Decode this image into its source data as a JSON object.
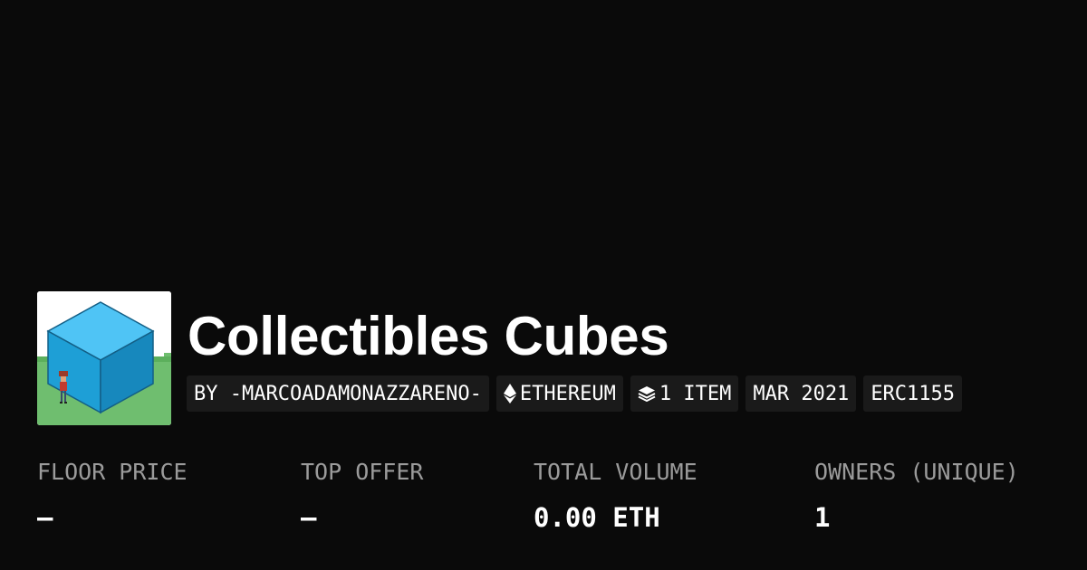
{
  "collection": {
    "name": "Collectibles Cubes",
    "avatar_icon": "isometric-blue-cube-image"
  },
  "tags": [
    {
      "label": "BY -MARCOADAMONAZZARENO-",
      "icon": null
    },
    {
      "label": "ETHEREUM",
      "icon": "ethereum-icon"
    },
    {
      "label": "1 ITEM",
      "icon": "layers-icon"
    },
    {
      "label": "MAR 2021",
      "icon": null
    },
    {
      "label": "ERC1155",
      "icon": null
    }
  ],
  "stats": [
    {
      "label": "FLOOR PRICE",
      "value": "–"
    },
    {
      "label": "TOP OFFER",
      "value": "–"
    },
    {
      "label": "TOTAL VOLUME",
      "value": "0.00 ETH"
    },
    {
      "label": "OWNERS (UNIQUE)",
      "value": "1"
    }
  ],
  "colors": {
    "background": "#0a0a0a",
    "pill_background": "#1a1a1a",
    "label_gray": "#9b9b9b",
    "cube_blue": "#1e9fd6",
    "grass_green": "#6fbe6f"
  }
}
